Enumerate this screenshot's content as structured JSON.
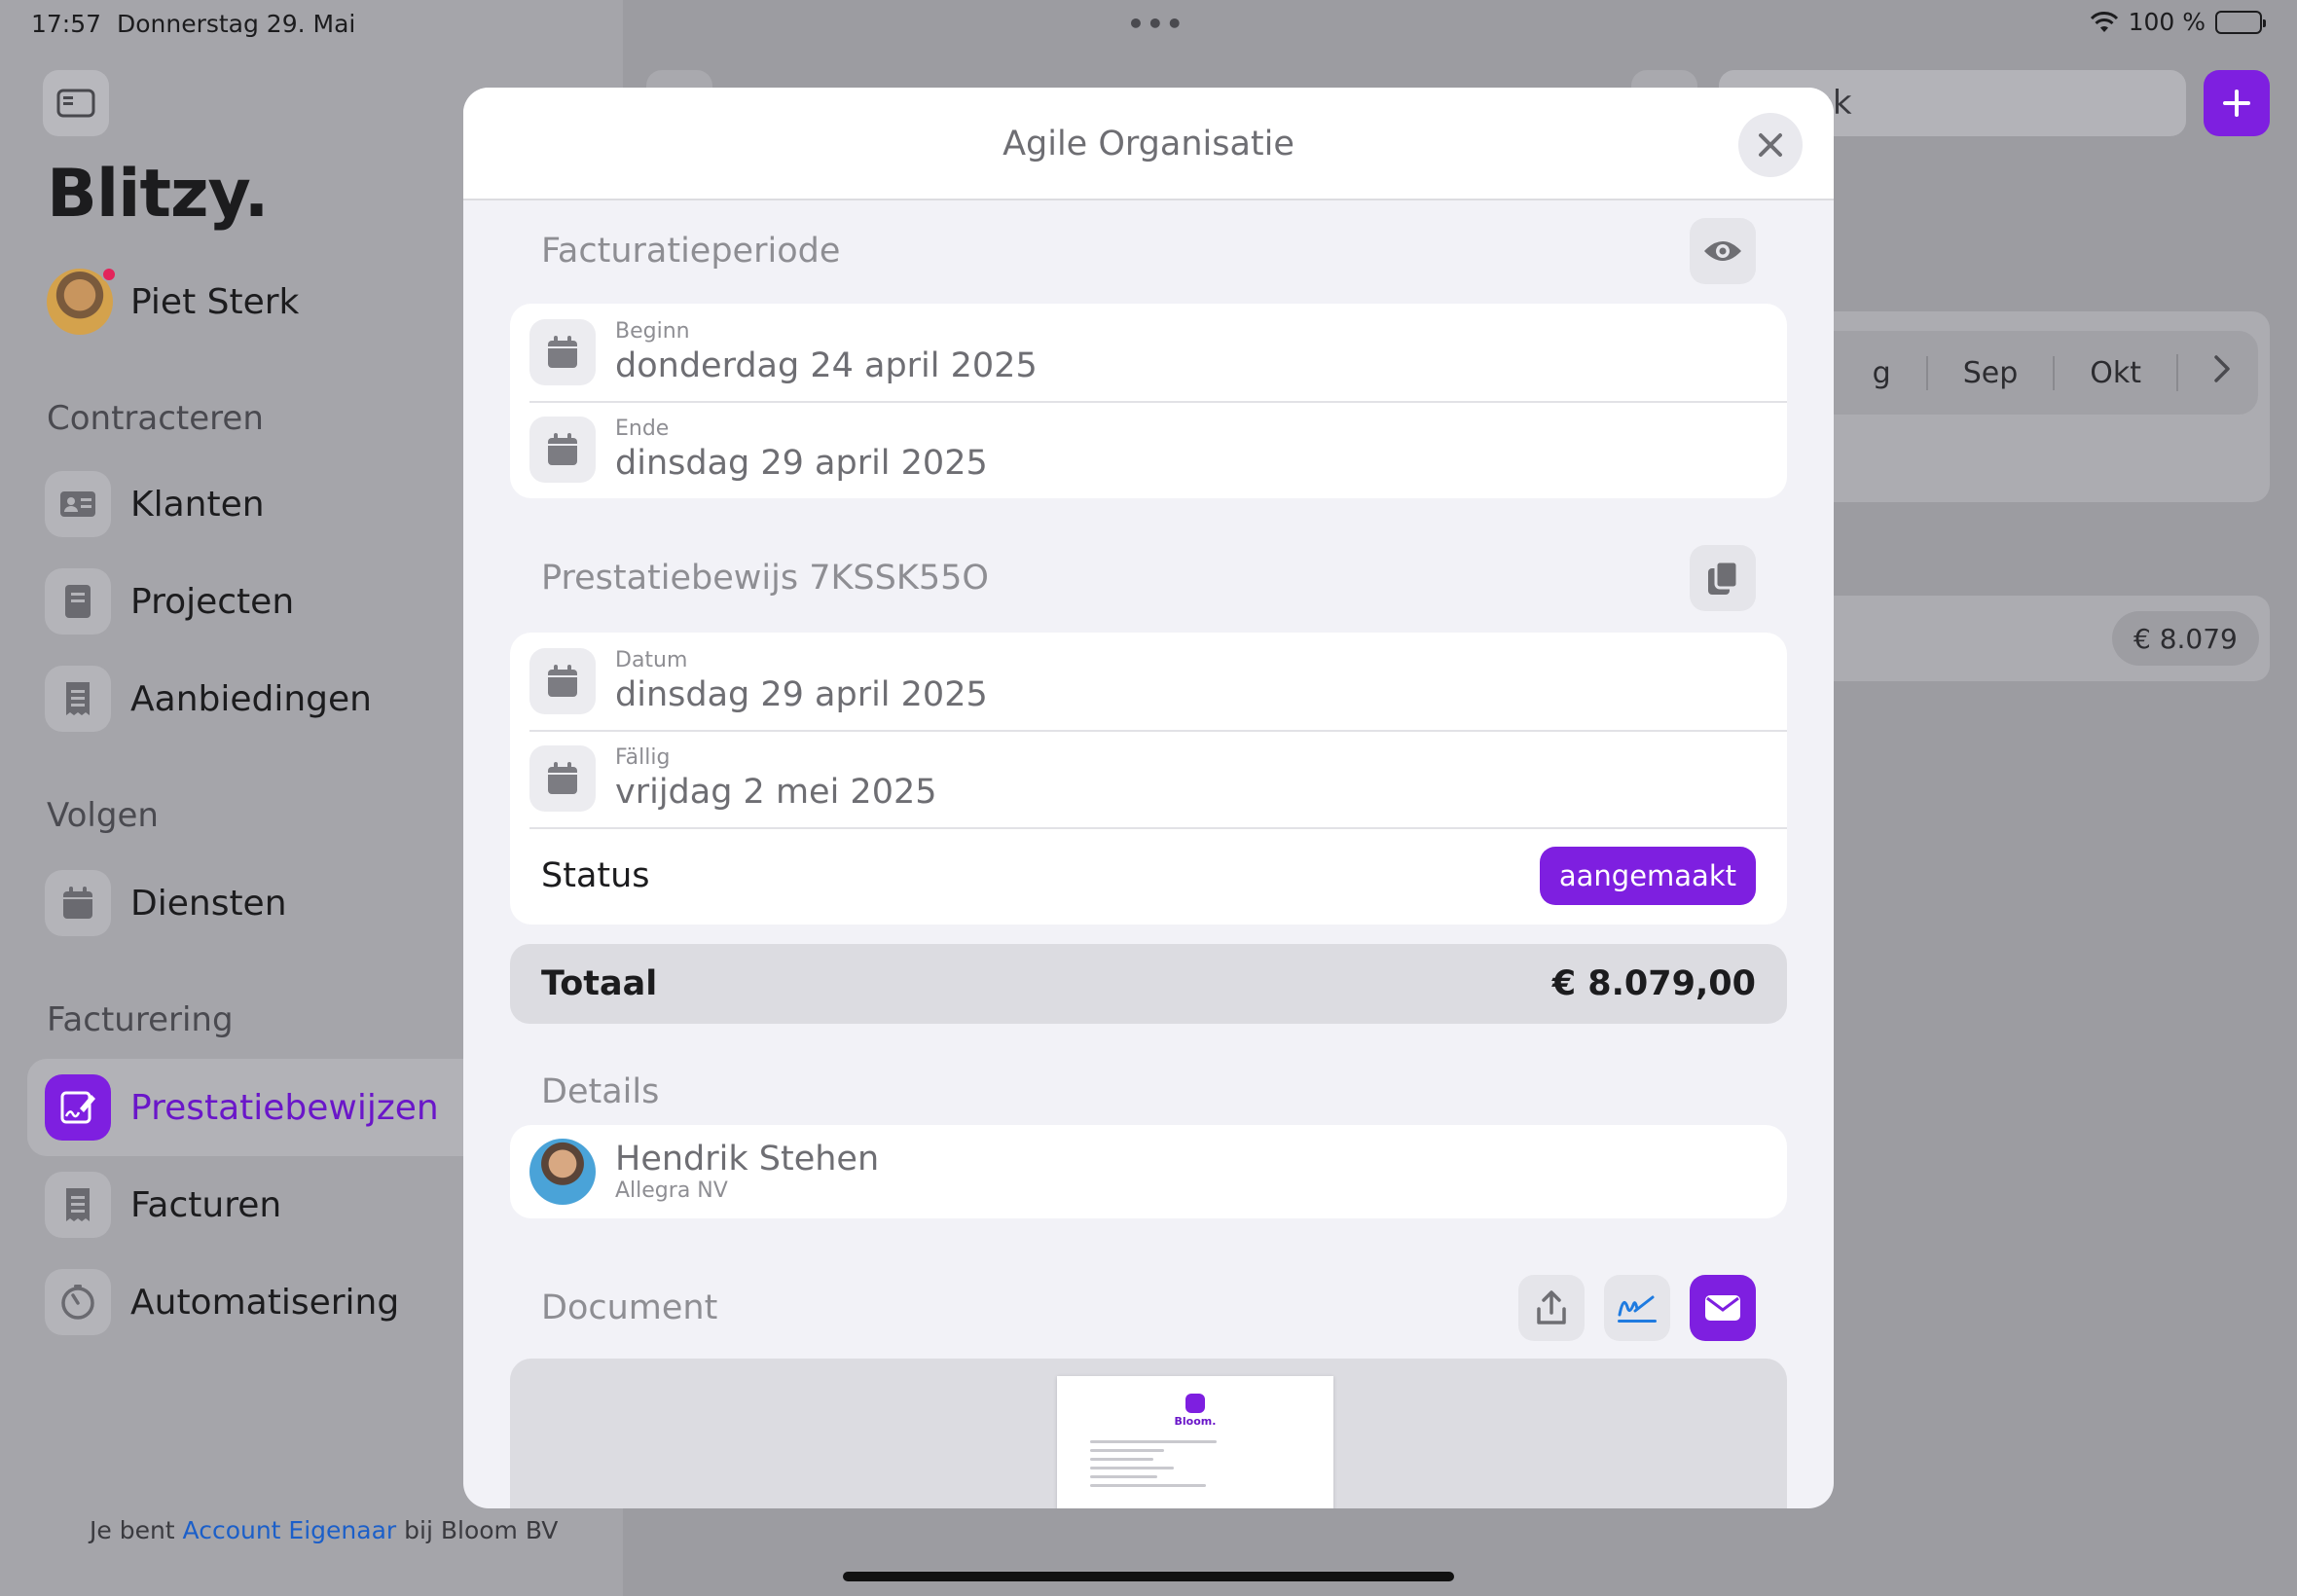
{
  "status_bar": {
    "time": "17:57",
    "date": "Donnerstag 29. Mai",
    "battery": "100 %"
  },
  "sidebar": {
    "app_title": "Blitzy.",
    "user_name": "Piet Sterk",
    "sections": [
      {
        "label": "Contracteren",
        "items": [
          {
            "label": "Klanten",
            "icon": "contact-card-icon"
          },
          {
            "label": "Projecten",
            "icon": "book-icon"
          },
          {
            "label": "Aanbiedingen",
            "icon": "receipt-icon"
          }
        ]
      },
      {
        "label": "Volgen",
        "items": [
          {
            "label": "Diensten",
            "icon": "calendar-icon"
          }
        ]
      },
      {
        "label": "Facturering",
        "items": [
          {
            "label": "Prestatiebewijzen",
            "icon": "signed-document-icon",
            "active": true
          },
          {
            "label": "Facturen",
            "icon": "receipt-icon"
          },
          {
            "label": "Automatisering",
            "icon": "timer-icon"
          }
        ]
      }
    ],
    "footer": {
      "prefix": "Je bent ",
      "role": "Account Eigenaar",
      "suffix": " bij Bloom BV"
    }
  },
  "background": {
    "months": [
      "g",
      "Sep",
      "Okt"
    ],
    "amount": "€ 8.079",
    "search_text": "ek"
  },
  "modal": {
    "title": "Agile Organisatie",
    "billing_period": {
      "title": "Facturatieperiode",
      "start_label": "Beginn",
      "start_value": "donderdag 24 april 2025",
      "end_label": "Ende",
      "end_value": "dinsdag 29 april 2025"
    },
    "proof": {
      "title": "Prestatiebewijs 7KSSK55O",
      "date_label": "Datum",
      "date_value": "dinsdag 29 april 2025",
      "due_label": "Fällig",
      "due_value": "vrijdag 2 mei 2025",
      "status_label": "Status",
      "status_value": "aangemaakt"
    },
    "total": {
      "label": "Totaal",
      "value": "€ 8.079,00"
    },
    "details": {
      "title": "Details",
      "contact_name": "Hendrik Stehen",
      "contact_company": "Allegra NV"
    },
    "document": {
      "title": "Document",
      "preview_brand": "Bloom."
    }
  },
  "colors": {
    "accent": "#7e1fe0",
    "link": "#1b5fc9",
    "badge_text": "#ffffff"
  }
}
